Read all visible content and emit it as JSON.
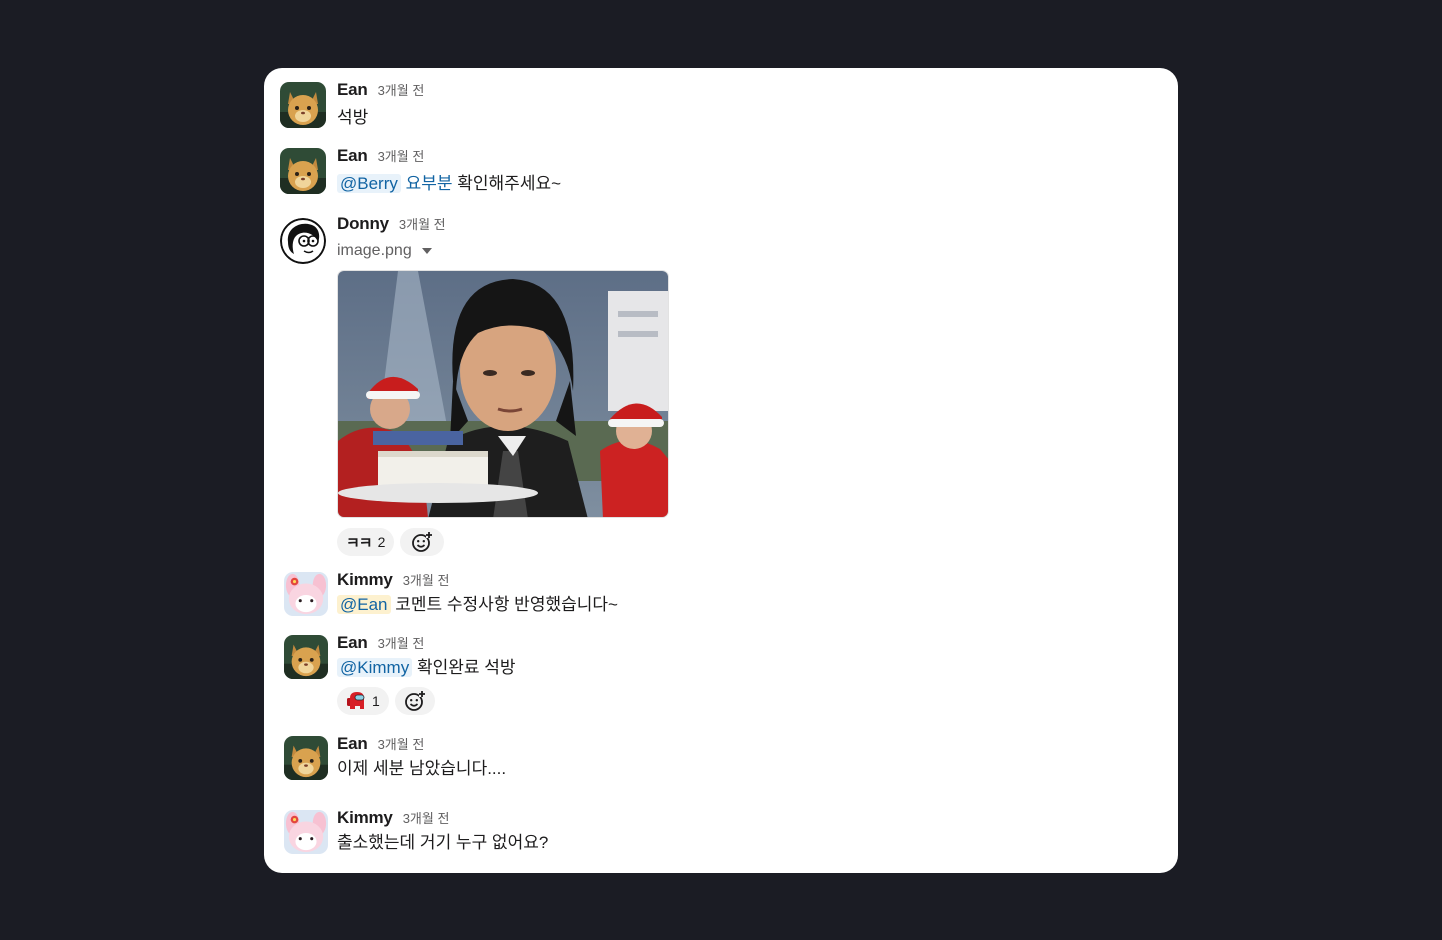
{
  "messages": [
    {
      "author": "Ean",
      "time": "3개월 전",
      "text": "석방"
    },
    {
      "author": "Ean",
      "time": "3개월 전",
      "mention": "@Berry",
      "keyword": "요부분",
      "text": "확인해주세요~"
    },
    {
      "author": "Donny",
      "time": "3개월 전",
      "file_name": "image.png",
      "reactions": [
        {
          "emoji": "ㅋㅋ",
          "count": "2"
        }
      ]
    },
    {
      "author": "Kimmy",
      "time": "3개월 전",
      "mention": "@Ean",
      "text": "코멘트 수정사항 반영했습니다~"
    },
    {
      "author": "Ean",
      "time": "3개월 전",
      "mention": "@Kimmy",
      "text": "확인완료 석방",
      "reactions": [
        {
          "emoji": "among-us-crewmate",
          "count": "1"
        }
      ]
    },
    {
      "author": "Ean",
      "time": "3개월 전",
      "text": "이제 세분 남았습니다...."
    },
    {
      "author": "Kimmy",
      "time": "3개월 전",
      "text": "출소했는데 거기 누구 없어요?"
    }
  ],
  "icons": {
    "add_reaction": "add-emoji-icon",
    "dropdown": "caret-down-icon"
  },
  "colors": {
    "background": "#1b1c24",
    "card": "#ffffff",
    "mention_text": "#1264a3",
    "mention_bg": "#e8f2fa",
    "self_mention_bg": "#fdf1cf"
  }
}
